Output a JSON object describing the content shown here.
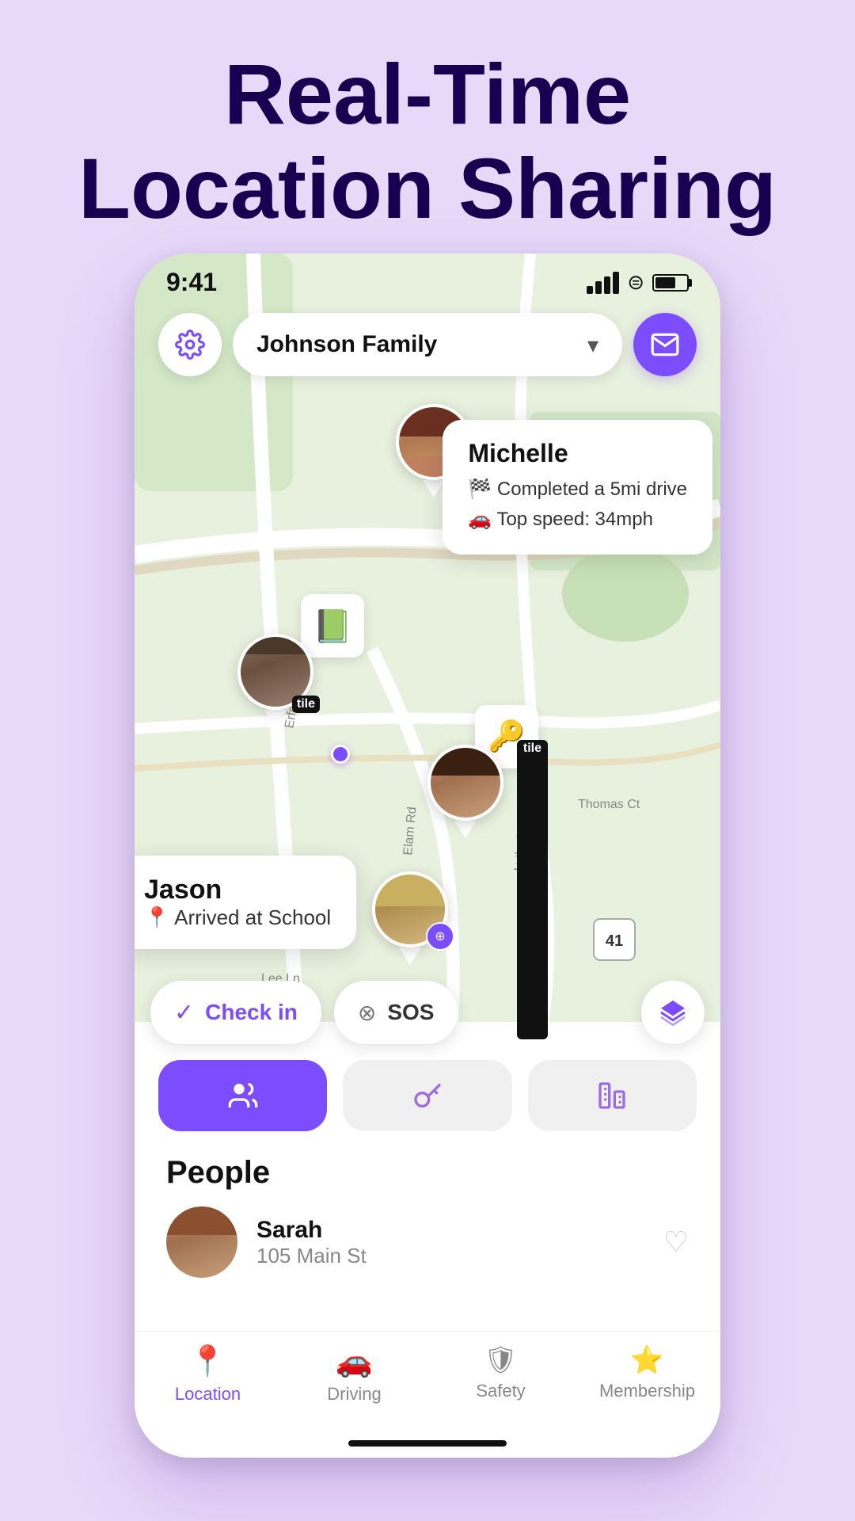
{
  "hero": {
    "line1": "Real-Time",
    "line2": "Location Sharing"
  },
  "status_bar": {
    "time": "9:41"
  },
  "header": {
    "family_name": "Johnson Family",
    "chevron": "▾"
  },
  "michelle_popup": {
    "name": "Michelle",
    "detail1": "🏁 Completed a 5mi drive",
    "detail2": "🚗 Top speed: 34mph"
  },
  "jason_popup": {
    "name": "Jason",
    "detail": "📍 Arrived at School"
  },
  "action_bar": {
    "checkin": "Check in",
    "sos": "SOS"
  },
  "people_section": {
    "title": "People",
    "person": {
      "name": "Sarah",
      "address": "105 Main St"
    }
  },
  "bottom_nav": {
    "items": [
      {
        "label": "Location",
        "active": true
      },
      {
        "label": "Driving",
        "active": false
      },
      {
        "label": "Safety",
        "active": false
      },
      {
        "label": "Membership",
        "active": false
      }
    ]
  }
}
